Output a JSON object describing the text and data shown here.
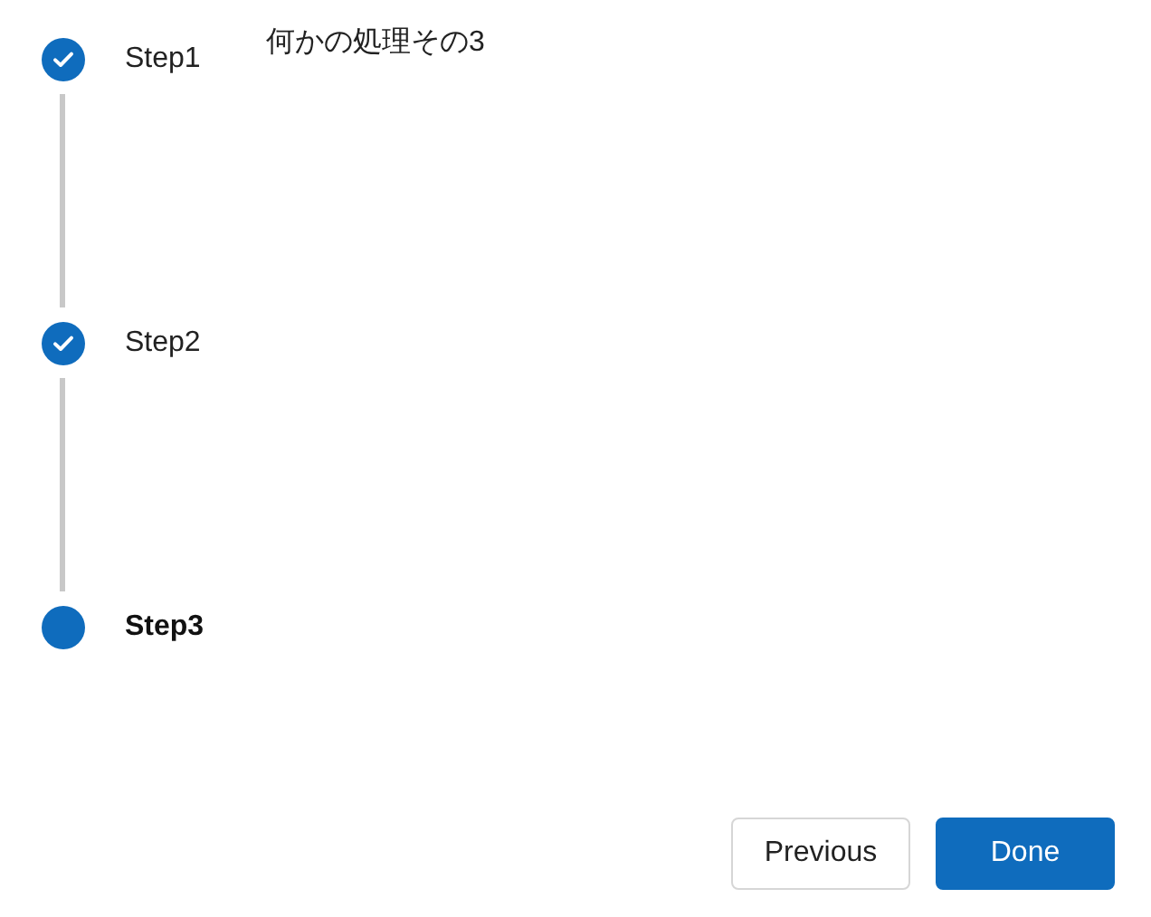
{
  "steps": [
    {
      "label": "Step1",
      "completed": true,
      "selected": false
    },
    {
      "label": "Step2",
      "completed": true,
      "selected": false
    },
    {
      "label": "Step3",
      "completed": false,
      "selected": true
    }
  ],
  "content": {
    "text": "何かの処理その3"
  },
  "buttons": [
    {
      "label": "Previous",
      "kind": "secondary"
    },
    {
      "label": "Done",
      "kind": "primary"
    }
  ]
}
